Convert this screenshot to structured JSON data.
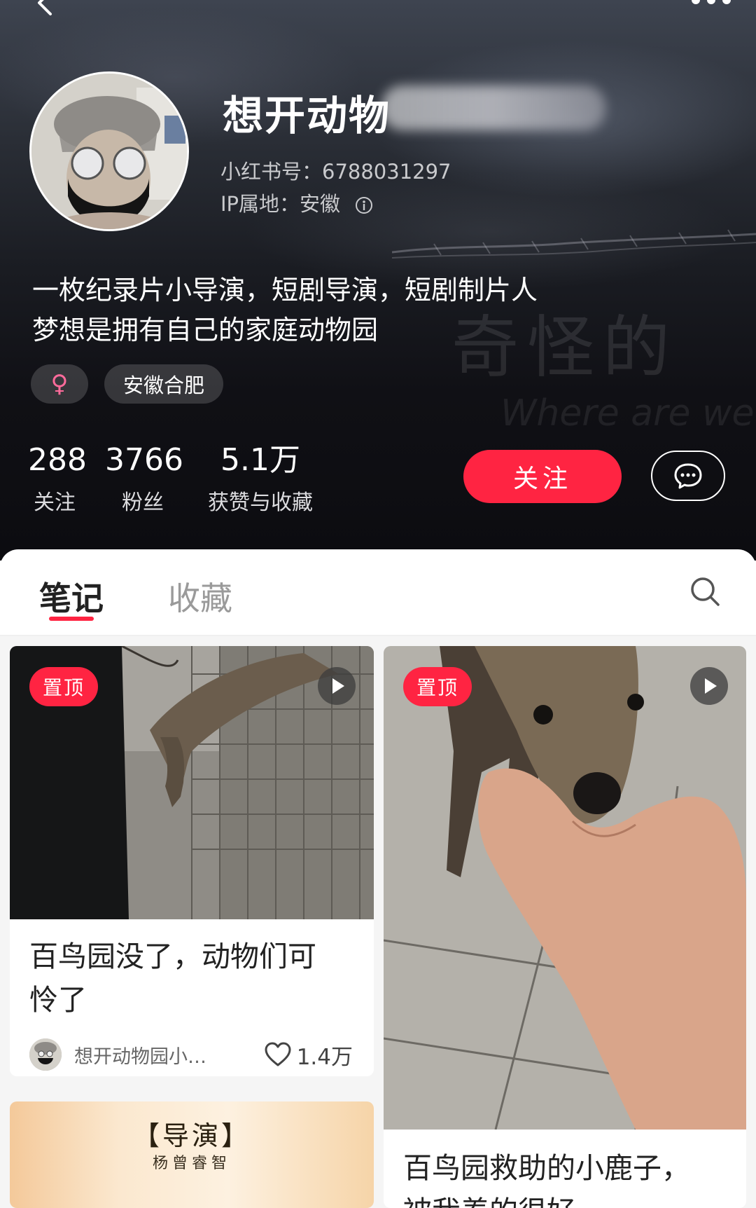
{
  "profile": {
    "name_visible": "想开动物",
    "xhs_id": "小红书号：6788031297",
    "ip_location": "IP属地：安徽",
    "bio_line1": "一枚纪录片小导演，短剧导演，短剧制片人",
    "bio_line2": "梦想是拥有自己的家庭动物园",
    "gender_symbol": "♀",
    "location_tag": "安徽合肥",
    "background_text_cn": "奇怪的",
    "background_text_en": "Where are we"
  },
  "stats": [
    {
      "value": "288",
      "label": "关注"
    },
    {
      "value": "3766",
      "label": "粉丝"
    },
    {
      "value": "5.1万",
      "label": "获赞与收藏"
    }
  ],
  "actions": {
    "follow_label": "关注"
  },
  "tabs": {
    "notes": "笔记",
    "collections": "收藏"
  },
  "cards": [
    {
      "badge": "置顶",
      "title_line1": "百鸟园没了，动物们可",
      "title_line2": "怜了",
      "author": "想开动物园小…",
      "likes": "1.4万"
    },
    {
      "badge": "置顶",
      "title_line1": "百鸟园救助的小鹿子，",
      "title_line2": "被我养的很好"
    },
    {
      "doc_line1": "【导演】",
      "doc_line2": "杨曾睿智"
    }
  ],
  "icons": {
    "back": "back-icon",
    "more": "more-icon",
    "info": "info-icon",
    "message": "message-icon",
    "search": "search-icon",
    "play": "play-icon",
    "heart": "heart-icon"
  },
  "colors": {
    "accent": "#ff2442",
    "header_dark": "#101015"
  }
}
